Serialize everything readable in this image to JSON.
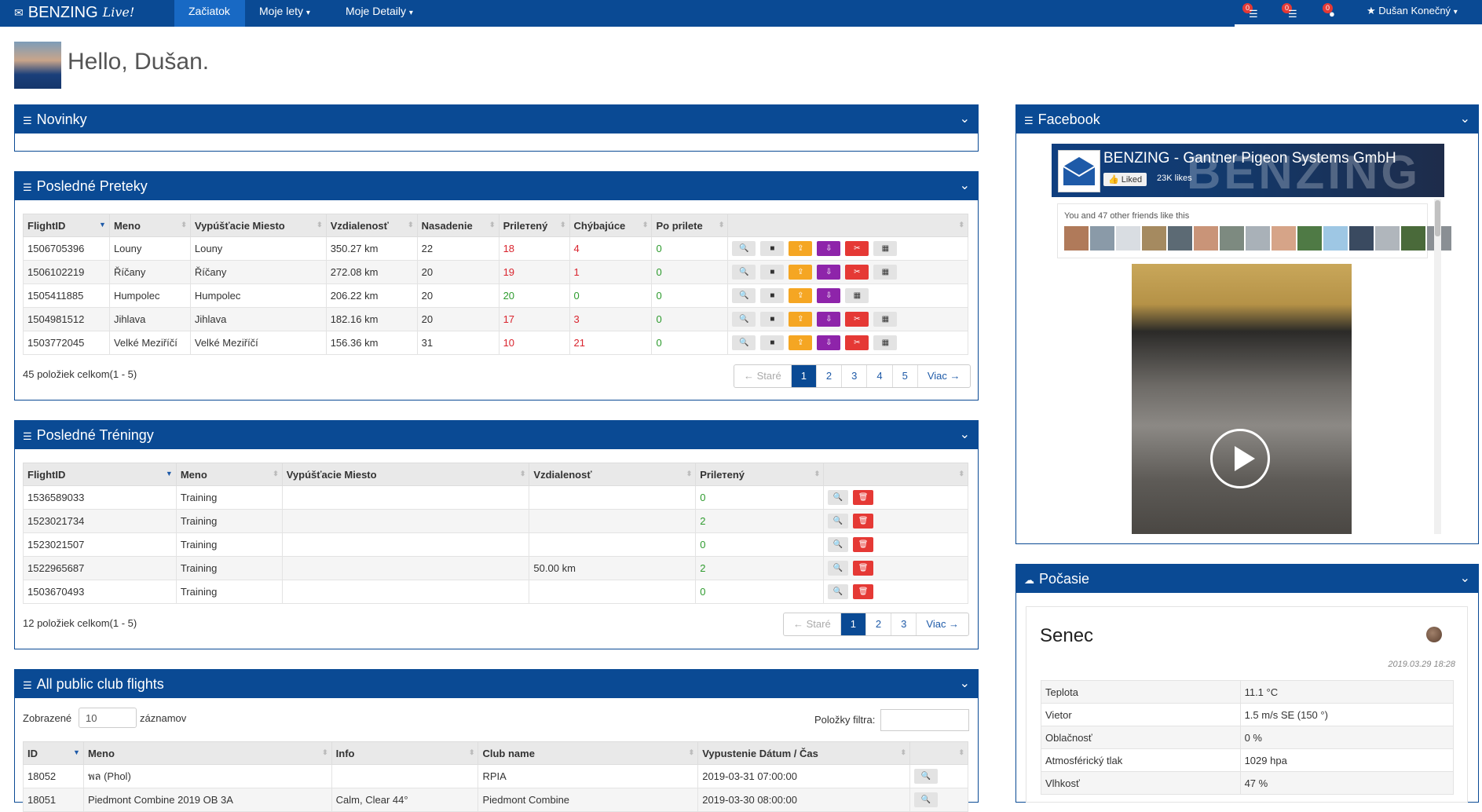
{
  "nav": {
    "brand": "BENZING",
    "brand_live": "Live!",
    "items": [
      {
        "label": "Začiatok",
        "active": true
      },
      {
        "label": "Moje lety",
        "active": false
      },
      {
        "label": "Moje Detaily",
        "active": false
      }
    ],
    "notifications": [
      "0",
      "0",
      "0"
    ],
    "user": "Dušan Konečný"
  },
  "greeting": "Hello, Dušan.",
  "novinky": {
    "title": "Novinky"
  },
  "preteky": {
    "title": "Posledné Preteky",
    "columns": [
      "FlightID",
      "Meno",
      "Vypúšťacie Miesto",
      "Vzdialenosť",
      "Nasadenie",
      "Prilетený",
      "Chýbajúce",
      "Po prilete"
    ],
    "rows": [
      [
        "1506705396",
        "Louny",
        "Louny",
        "350.27 km",
        "22",
        "18",
        "4",
        "0"
      ],
      [
        "1506102219",
        "Říčany",
        "Říčany",
        "272.08 km",
        "20",
        "19",
        "1",
        "0"
      ],
      [
        "1505411885",
        "Humpolec",
        "Humpolec",
        "206.22 km",
        "20",
        "20",
        "0",
        "0"
      ],
      [
        "1504981512",
        "Jihlava",
        "Jihlava",
        "182.16 km",
        "20",
        "17",
        "3",
        "0"
      ],
      [
        "1503772045",
        "Velké Meziříčí",
        "Velké Meziříčí",
        "156.36 km",
        "31",
        "10",
        "21",
        "0"
      ]
    ],
    "info": "45 položiek celkom(1 - 5)",
    "pager": [
      "← Staré",
      "1",
      "2",
      "3",
      "4",
      "5",
      "Viac →"
    ]
  },
  "treningy": {
    "title": "Posledné Tréningy",
    "columns": [
      "FlightID",
      "Meno",
      "Vypúšťacie Miesto",
      "Vzdialenosť",
      "Prilетený"
    ],
    "rows": [
      [
        "1536589033",
        "Training",
        "",
        "",
        "0"
      ],
      [
        "1523021734",
        "Training",
        "",
        "",
        "2"
      ],
      [
        "1523021507",
        "Training",
        "",
        "",
        "0"
      ],
      [
        "1522965687",
        "Training",
        "",
        "50.00 km",
        "2"
      ],
      [
        "1503670493",
        "Training",
        "",
        "",
        "0"
      ]
    ],
    "info": "12 položiek celkom(1 - 5)",
    "pager": [
      "← Staré",
      "1",
      "2",
      "3",
      "Viac →"
    ]
  },
  "club": {
    "title": "All public club flights",
    "show_label": "Zobrazené",
    "show_value": "10",
    "records_label": "záznamov",
    "filter_label": "Položky filtra:",
    "columns": [
      "ID",
      "Meno",
      "Info",
      "Club name",
      "Vypustenie Dátum / Čas"
    ],
    "rows": [
      [
        "18052",
        "พล (Phol)",
        "",
        "RPIA",
        "2019-03-31 07:00:00"
      ],
      [
        "18051",
        "Piedmont Combine 2019 OB 3A",
        "Calm, Clear 44°",
        "Piedmont Combine",
        "2019-03-30 08:00:00"
      ]
    ]
  },
  "facebook": {
    "title": "Facebook",
    "page_name": "BENZING - Gantner Pigeon Systems GmbH",
    "liked": "Liked",
    "likes": "23K likes",
    "friends_text": "You and 47 other friends like this",
    "cover_text": "BENZING"
  },
  "weather": {
    "title": "Počasie",
    "city": "Senec",
    "timestamp": "2019.03.29 18:28",
    "rows": [
      [
        "Teplota",
        "11.1 °C"
      ],
      [
        "Vietor",
        "1.5 m/s SE (150 °)"
      ],
      [
        "Oblačnosť",
        "0 %"
      ],
      [
        "Atmosférický tlak",
        "1029 hpa"
      ],
      [
        "Vlhkosť",
        "47 %"
      ]
    ]
  }
}
